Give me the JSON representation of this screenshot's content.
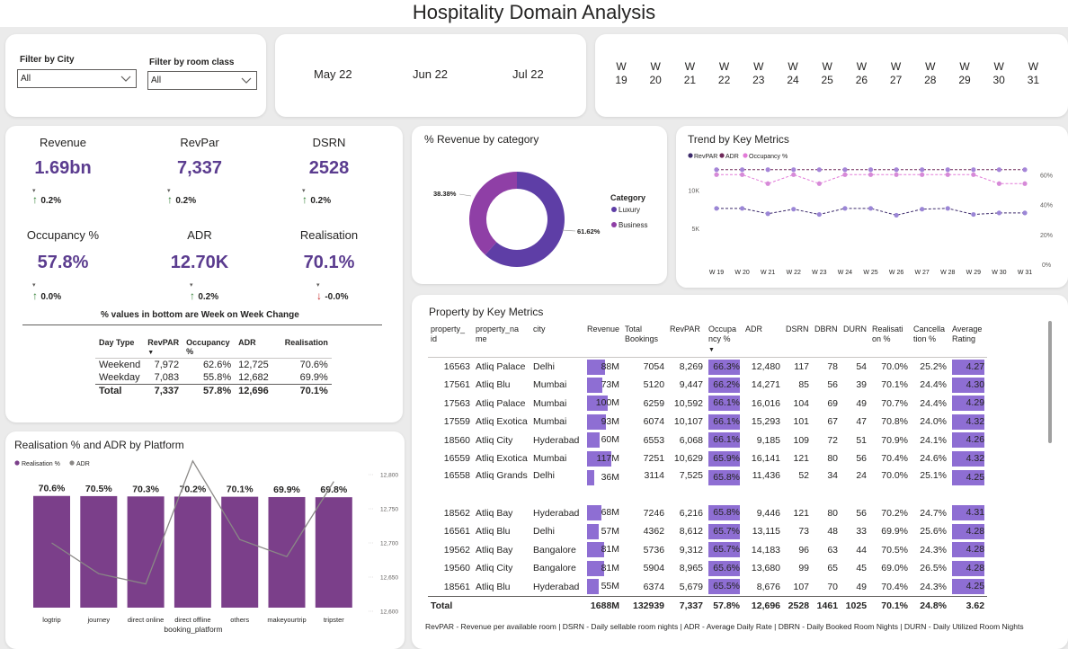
{
  "title": "Hospitality Domain Analysis",
  "filters": {
    "city_label": "Filter by City",
    "city_value": "All",
    "room_label": "Filter by room class",
    "room_value": "All"
  },
  "months": [
    "May 22",
    "Jun 22",
    "Jul 22"
  ],
  "weeks": [
    {
      "w": "W",
      "n": "19"
    },
    {
      "w": "W",
      "n": "20"
    },
    {
      "w": "W",
      "n": "21"
    },
    {
      "w": "W",
      "n": "22"
    },
    {
      "w": "W",
      "n": "23"
    },
    {
      "w": "W",
      "n": "24"
    },
    {
      "w": "W",
      "n": "25"
    },
    {
      "w": "W",
      "n": "26"
    },
    {
      "w": "W",
      "n": "27"
    },
    {
      "w": "W",
      "n": "28"
    },
    {
      "w": "W",
      "n": "29"
    },
    {
      "w": "W",
      "n": "30"
    },
    {
      "w": "W",
      "n": "31"
    }
  ],
  "kpis": [
    {
      "label": "Revenue",
      "value": "1.69bn",
      "change": "0.2%",
      "dir": "up"
    },
    {
      "label": "RevPar",
      "value": "7,337",
      "change": "0.2%",
      "dir": "up"
    },
    {
      "label": "DSRN",
      "value": "2528",
      "change": "0.2%",
      "dir": "up"
    },
    {
      "label": "Occupancy %",
      "value": "57.8%",
      "change": "0.0%",
      "dir": "up"
    },
    {
      "label": "ADR",
      "value": "12.70K",
      "change": "0.2%",
      "dir": "up"
    },
    {
      "label": "Realisation",
      "value": "70.1%",
      "change": "-0.0%",
      "dir": "down"
    }
  ],
  "wow_note": "% values in bottom are Week on Week Change",
  "daytype": {
    "headers": [
      "Day Type",
      "RevPAR",
      "Occupancy %",
      "ADR",
      "Realisation"
    ],
    "rows": [
      [
        "Weekend",
        "7,972",
        "62.6%",
        "12,725",
        "70.6%"
      ],
      [
        "Weekday",
        "7,083",
        "55.8%",
        "12,682",
        "69.9%"
      ]
    ],
    "total": [
      "Total",
      "7,337",
      "57.8%",
      "12,696",
      "70.1%"
    ]
  },
  "colors": {
    "purple_dark": "#5b3c8f",
    "luxury": "#5e3ea6",
    "business": "#8f3fa6",
    "bar_platform": "#7b3f8a",
    "cell_bar": "#8e6ed3",
    "up": "#2e7d32",
    "down": "#c62828"
  },
  "donut": {
    "title": "% Revenue by category",
    "legend_title": "Category",
    "slices": [
      {
        "name": "Luxury",
        "pct": 61.62,
        "label": "61.62%"
      },
      {
        "name": "Business",
        "pct": 38.38,
        "label": "38.38%"
      }
    ]
  },
  "trend": {
    "title": "Trend by Key Metrics",
    "legend": [
      "RevPAR",
      "ADR",
      "Occupancy %"
    ],
    "left_ticks": [
      "10K",
      "5K"
    ],
    "right_ticks": [
      "60%",
      "40%",
      "20%",
      "0%"
    ]
  },
  "platform": {
    "title": "Realisation % and ADR by Platform",
    "legend": [
      "Realisation %",
      "ADR"
    ],
    "xlabel": "booking_platform",
    "right_ticks": [
      "12,800",
      "12,750",
      "12,700",
      "12,650",
      "12,600"
    ]
  },
  "chart_data": [
    {
      "type": "pie",
      "title": "% Revenue by category",
      "categories": [
        "Luxury",
        "Business"
      ],
      "values": [
        61.62,
        38.38
      ]
    },
    {
      "type": "line",
      "title": "Trend by Key Metrics",
      "x": [
        "W 19",
        "W 20",
        "W 21",
        "W 22",
        "W 23",
        "W 24",
        "W 25",
        "W 26",
        "W 27",
        "W 28",
        "W 29",
        "W 30",
        "W 31"
      ],
      "series": [
        {
          "name": "RevPAR",
          "values": [
            7600,
            7600,
            6900,
            7500,
            6800,
            7600,
            7600,
            6700,
            7500,
            7600,
            6800,
            7000,
            7000
          ]
        },
        {
          "name": "ADR",
          "values": [
            12700,
            12700,
            12700,
            12700,
            12700,
            12700,
            12700,
            12700,
            12700,
            12700,
            12700,
            12700,
            12700
          ]
        },
        {
          "name": "Occupancy %",
          "values": [
            60,
            60,
            54,
            60,
            54,
            60,
            60,
            60,
            60,
            60,
            60,
            54,
            54
          ]
        }
      ],
      "ylim": [
        0,
        13500
      ],
      "ylim_right": [
        0,
        65
      ]
    },
    {
      "type": "bar",
      "title": "Realisation % and ADR by Platform",
      "categories": [
        "logtrip",
        "journey",
        "direct online",
        "direct offline",
        "others",
        "makeyourtrip",
        "tripster"
      ],
      "series": [
        {
          "name": "Realisation %",
          "values": [
            70.6,
            70.5,
            70.3,
            70.2,
            70.1,
            69.9,
            69.8
          ],
          "labels": [
            "70.6%",
            "70.5%",
            "70.3%",
            "70.2%",
            "70.1%",
            "69.9%",
            "69.8%"
          ]
        },
        {
          "name": "ADR",
          "values": [
            12700,
            12655,
            12640,
            12820,
            12705,
            12680,
            12790
          ]
        }
      ],
      "xlabel": "booking_platform",
      "ylim_right": [
        12600,
        12800
      ]
    }
  ],
  "property": {
    "title": "Property by Key Metrics",
    "headers": [
      "property_ id",
      "property_na me",
      "city",
      "Revenue",
      "Total Bookings",
      "RevPAR",
      "Occupa ncy %",
      "ADR",
      "DSRN",
      "DBRN",
      "DURN",
      "Realisati on %",
      "Cancella tion %",
      "Average Rating"
    ],
    "rows": [
      {
        "id": "16563",
        "name": "Atliq Palace",
        "city": "Delhi",
        "rev": "88M",
        "rev_v": 88,
        "bookings": "7054",
        "revpar": "8,269",
        "occ": "66.3%",
        "occ_v": 66.3,
        "adr": "12,480",
        "dsrn": "117",
        "dbrn": "78",
        "durn": "54",
        "real": "70.0%",
        "canc": "25.2%",
        "rating": "4.27",
        "rating_v": 4.27
      },
      {
        "id": "17561",
        "name": "Atliq Blu",
        "city": "Mumbai",
        "rev": "73M",
        "rev_v": 73,
        "bookings": "5120",
        "revpar": "9,447",
        "occ": "66.2%",
        "occ_v": 66.2,
        "adr": "14,271",
        "dsrn": "85",
        "dbrn": "56",
        "durn": "39",
        "real": "70.1%",
        "canc": "24.4%",
        "rating": "4.30",
        "rating_v": 4.3
      },
      {
        "id": "17563",
        "name": "Atliq Palace",
        "city": "Mumbai",
        "rev": "100M",
        "rev_v": 100,
        "bookings": "6259",
        "revpar": "10,592",
        "occ": "66.1%",
        "occ_v": 66.1,
        "adr": "16,016",
        "dsrn": "104",
        "dbrn": "69",
        "durn": "49",
        "real": "70.7%",
        "canc": "24.4%",
        "rating": "4.29",
        "rating_v": 4.29
      },
      {
        "id": "17559",
        "name": "Atliq Exotica",
        "city": "Mumbai",
        "rev": "93M",
        "rev_v": 93,
        "bookings": "6074",
        "revpar": "10,107",
        "occ": "66.1%",
        "occ_v": 66.1,
        "adr": "15,293",
        "dsrn": "101",
        "dbrn": "67",
        "durn": "47",
        "real": "70.8%",
        "canc": "24.0%",
        "rating": "4.32",
        "rating_v": 4.32
      },
      {
        "id": "18560",
        "name": "Atliq City",
        "city": "Hyderabad",
        "rev": "60M",
        "rev_v": 60,
        "bookings": "6553",
        "revpar": "6,068",
        "occ": "66.1%",
        "occ_v": 66.1,
        "adr": "9,185",
        "dsrn": "109",
        "dbrn": "72",
        "durn": "51",
        "real": "70.9%",
        "canc": "24.1%",
        "rating": "4.26",
        "rating_v": 4.26
      },
      {
        "id": "16559",
        "name": "Atliq Exotica",
        "city": "Mumbai",
        "rev": "117M",
        "rev_v": 117,
        "bookings": "7251",
        "revpar": "10,629",
        "occ": "65.9%",
        "occ_v": 65.9,
        "adr": "16,141",
        "dsrn": "121",
        "dbrn": "80",
        "durn": "56",
        "real": "70.4%",
        "canc": "24.6%",
        "rating": "4.32",
        "rating_v": 4.32
      },
      {
        "id": "16558",
        "name": "Atliq Grands",
        "city": "Delhi",
        "rev": "36M",
        "rev_v": 36,
        "bookings": "3114",
        "revpar": "7,525",
        "occ": "65.8%",
        "occ_v": 65.8,
        "adr": "11,436",
        "dsrn": "52",
        "dbrn": "34",
        "durn": "24",
        "real": "70.0%",
        "canc": "25.1%",
        "rating": "4.25",
        "rating_v": 4.25
      },
      {
        "id": "18562",
        "name": "Atliq Bay",
        "city": "Hyderabad",
        "rev": "68M",
        "rev_v": 68,
        "bookings": "7246",
        "revpar": "6,216",
        "occ": "65.8%",
        "occ_v": 65.8,
        "adr": "9,446",
        "dsrn": "121",
        "dbrn": "80",
        "durn": "56",
        "real": "70.2%",
        "canc": "24.7%",
        "rating": "4.31",
        "rating_v": 4.31
      },
      {
        "id": "16561",
        "name": "Atliq Blu",
        "city": "Delhi",
        "rev": "57M",
        "rev_v": 57,
        "bookings": "4362",
        "revpar": "8,612",
        "occ": "65.7%",
        "occ_v": 65.7,
        "adr": "13,115",
        "dsrn": "73",
        "dbrn": "48",
        "durn": "33",
        "real": "69.9%",
        "canc": "25.6%",
        "rating": "4.28",
        "rating_v": 4.28
      },
      {
        "id": "19562",
        "name": "Atliq Bay",
        "city": "Bangalore",
        "rev": "81M",
        "rev_v": 81,
        "bookings": "5736",
        "revpar": "9,312",
        "occ": "65.7%",
        "occ_v": 65.7,
        "adr": "14,183",
        "dsrn": "96",
        "dbrn": "63",
        "durn": "44",
        "real": "70.5%",
        "canc": "24.3%",
        "rating": "4.28",
        "rating_v": 4.28
      },
      {
        "id": "19560",
        "name": "Atliq City",
        "city": "Bangalore",
        "rev": "81M",
        "rev_v": 81,
        "bookings": "5904",
        "revpar": "8,965",
        "occ": "65.6%",
        "occ_v": 65.6,
        "adr": "13,680",
        "dsrn": "99",
        "dbrn": "65",
        "durn": "45",
        "real": "69.0%",
        "canc": "26.5%",
        "rating": "4.28",
        "rating_v": 4.28
      },
      {
        "id": "18561",
        "name": "Atliq Blu",
        "city": "Hyderabad",
        "rev": "55M",
        "rev_v": 55,
        "bookings": "6374",
        "revpar": "5,679",
        "occ": "65.5%",
        "occ_v": 65.5,
        "adr": "8,676",
        "dsrn": "107",
        "dbrn": "70",
        "durn": "49",
        "real": "70.4%",
        "canc": "24.3%",
        "rating": "4.25",
        "rating_v": 4.25
      }
    ],
    "total": {
      "id": "Total",
      "rev": "1688M",
      "bookings": "132939",
      "revpar": "7,337",
      "occ": "57.8%",
      "adr": "12,696",
      "dsrn": "2528",
      "dbrn": "1461",
      "durn": "1025",
      "real": "70.1%",
      "canc": "24.8%",
      "rating": "3.62"
    },
    "footnote": "RevPAR - Revenue per available room | DSRN - Daily sellable room nights | ADR - Average Daily Rate | DBRN - Daily Booked Room Nights | DURN - Daily Utilized Room Nights"
  }
}
